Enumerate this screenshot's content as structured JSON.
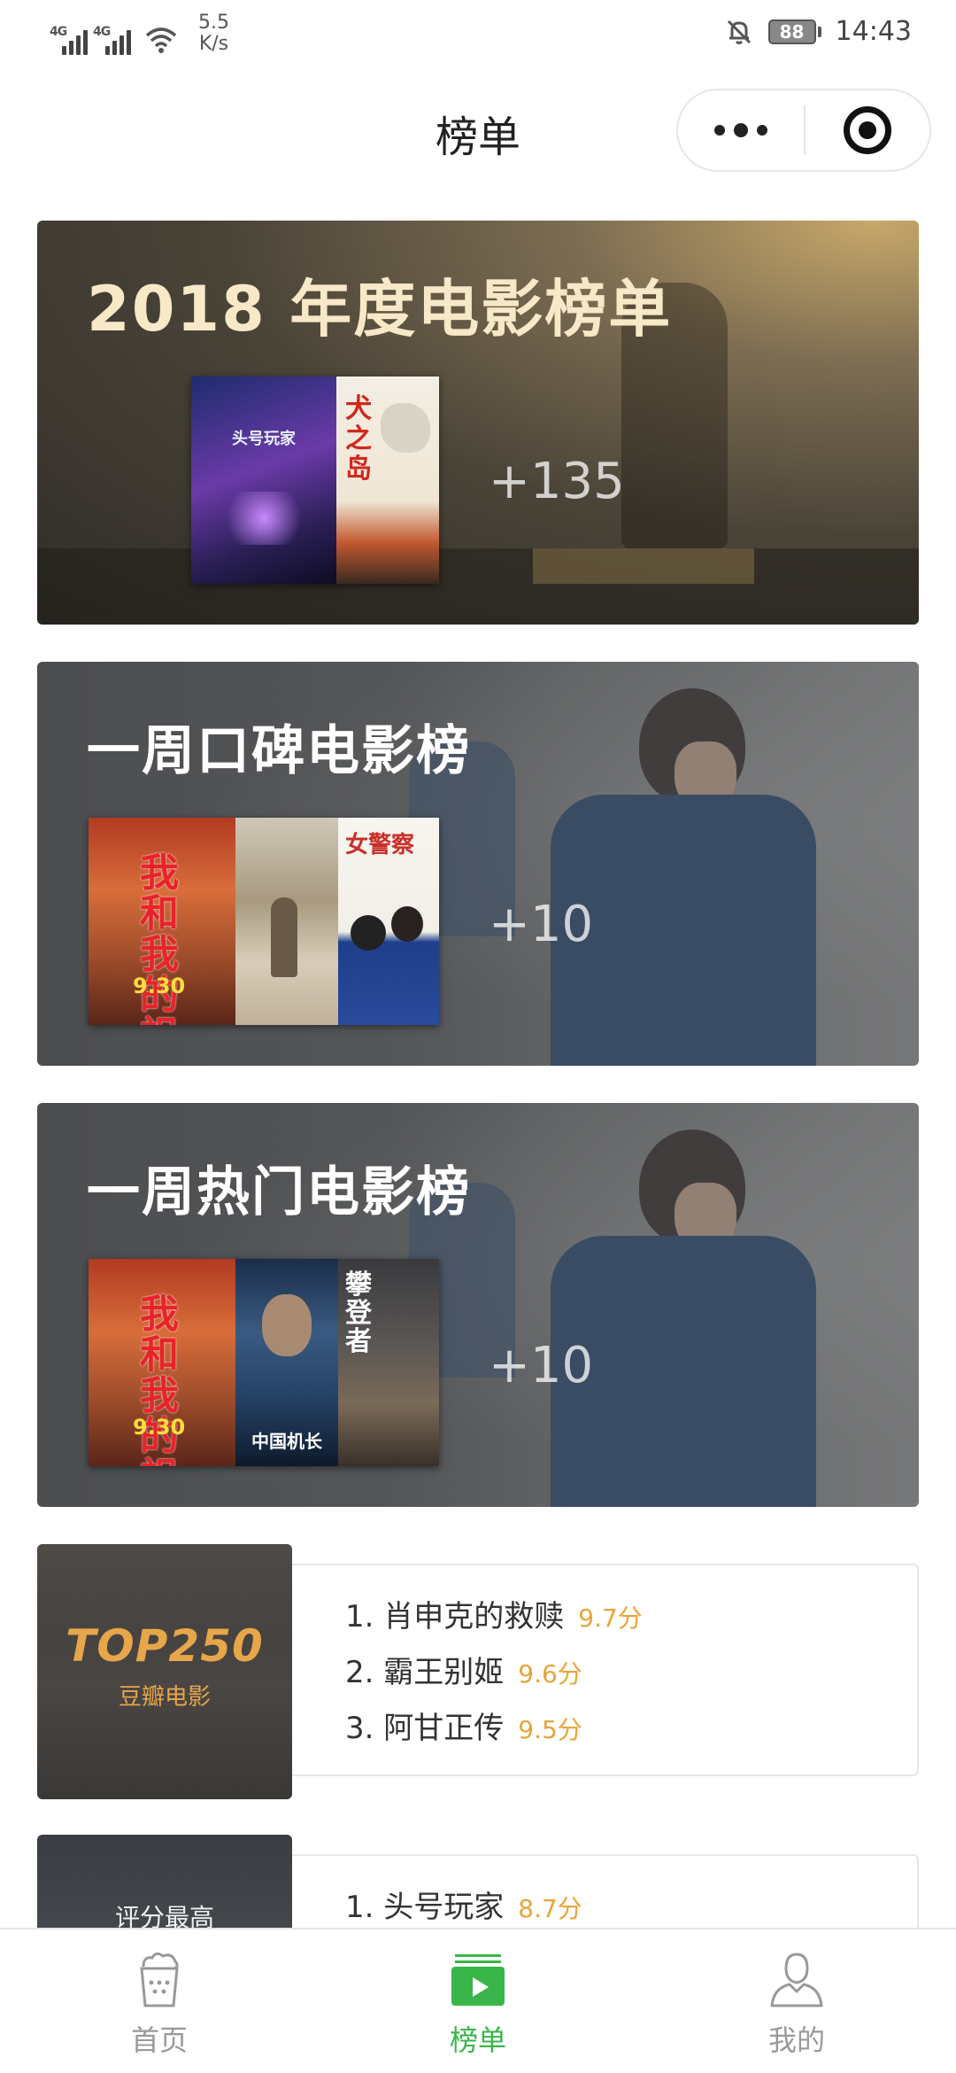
{
  "status_bar": {
    "network_1": "4G",
    "network_2": "4G",
    "speed_value": "5.5",
    "speed_unit": "K/s",
    "battery": "88",
    "time": "14:43"
  },
  "nav": {
    "title": "榜单"
  },
  "banners": [
    {
      "title": "2018 年度电影榜单",
      "more_count": "+135"
    },
    {
      "title": "一周口碑电影榜",
      "more_count": "+10"
    },
    {
      "title": "一周热门电影榜",
      "more_count": "+10"
    }
  ],
  "lists": [
    {
      "cover_title": "TOP250",
      "cover_subtitle": "豆瓣电影",
      "items": [
        {
          "name": "1. 肖申克的救赎",
          "score": "9.7分"
        },
        {
          "name": "2. 霸王别姬",
          "score": "9.6分"
        },
        {
          "name": "3. 阿甘正传",
          "score": "9.5分"
        }
      ]
    },
    {
      "cover_title": "评分最高",
      "items": [
        {
          "name": "1. 头号玩家",
          "score": "8.7分"
        }
      ]
    }
  ],
  "posters": {
    "b1_p1_title": "头号玩家",
    "b1_p2_title": "犬之岛",
    "b2_p1_title": "我和我的祖国",
    "b2_p1_date": "9.30",
    "b2_p3_title": "女警察",
    "b3_p1_title": "我和我的祖国",
    "b3_p1_date": "9.30",
    "b3_p2_title": "中国机长",
    "b3_p3_title": "攀登者"
  },
  "tabs": [
    {
      "label": "首页",
      "icon": "popcorn-icon"
    },
    {
      "label": "榜单",
      "icon": "list-play-icon"
    },
    {
      "label": "我的",
      "icon": "person-icon"
    }
  ],
  "colors": {
    "accent_green": "#39b54a",
    "score_orange": "#e8a53a",
    "banner1_bg": "#4a4438",
    "banner_gray": "#55585a"
  }
}
